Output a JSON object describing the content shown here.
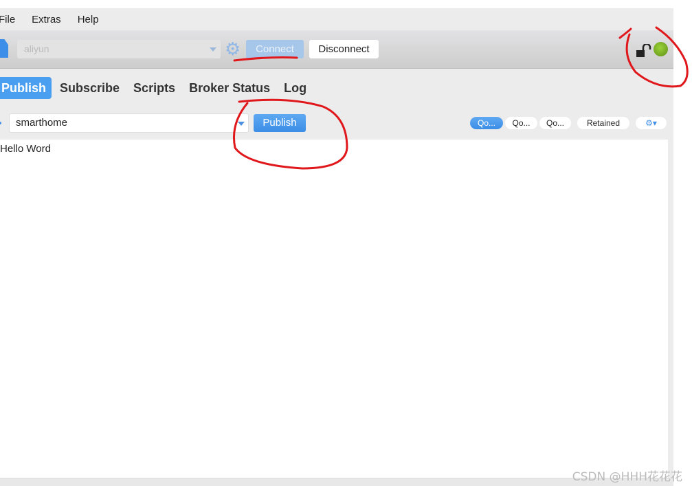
{
  "menu": {
    "items": [
      "File",
      "Extras",
      "Help"
    ]
  },
  "toolbar": {
    "profile": "aliyun",
    "connect_label": "Connect",
    "disconnect_label": "Disconnect",
    "status_icons": [
      "unlock-icon",
      "connection-status-led"
    ],
    "status_color": "#7cb82a"
  },
  "tabs": [
    {
      "label": "Publish",
      "active": true
    },
    {
      "label": "Subscribe"
    },
    {
      "label": "Scripts"
    },
    {
      "label": "Broker Status"
    },
    {
      "label": "Log"
    }
  ],
  "publish": {
    "topic": "smarthome",
    "publish_label": "Publish",
    "qos": [
      "Qo...",
      "Qo...",
      "Qo..."
    ],
    "qos_selected": 0,
    "retained_label": "Retained",
    "message": "Hello Word"
  },
  "watermark": "CSDN @HHH花花花",
  "colors": {
    "accent": "#4a9ff0",
    "annotation": "#e0181c"
  }
}
